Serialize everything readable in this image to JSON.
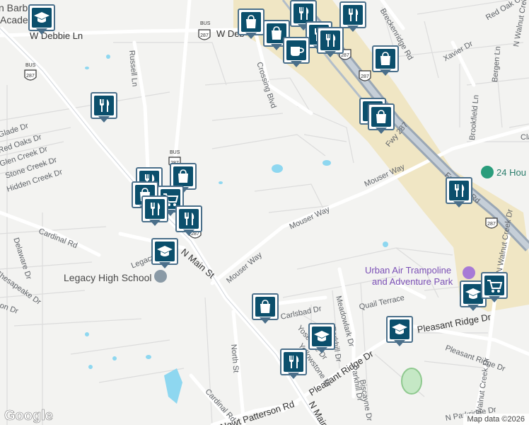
{
  "street_labels": [
    {
      "text": "W Debbie Ln",
      "name": "street-label-w-debbie-ln"
    },
    {
      "text": "W Deb",
      "name": "street-label-w-debbie-ln-east"
    },
    {
      "text": "Russell Ln",
      "name": "street-label-russell-ln"
    },
    {
      "text": "Glade Dr",
      "name": "street-label-glade-dr"
    },
    {
      "text": "Red Oaks Dr",
      "name": "street-label-red-oaks-dr"
    },
    {
      "text": "Glen Creek Dr",
      "name": "street-label-glen-creek-dr"
    },
    {
      "text": "Stone Creek Dr",
      "name": "street-label-stone-creek-dr"
    },
    {
      "text": "Hidden Creek Dr",
      "name": "street-label-hidden-creek-dr"
    },
    {
      "text": "Cardinal Rd",
      "name": "street-label-cardinal-rd-west"
    },
    {
      "text": "Delaware Dr",
      "name": "street-label-delaware-dr"
    },
    {
      "text": "Chesapeake Dr",
      "name": "street-label-chesapeake-dr"
    },
    {
      "text": "on Dr",
      "name": "street-label-on-dr"
    },
    {
      "text": "Legacy Dr",
      "name": "street-label-legacy-dr"
    },
    {
      "text": "N Main St",
      "name": "street-label-n-main-st"
    },
    {
      "text": "Mouser Way",
      "name": "street-label-mouser-way"
    },
    {
      "text": "Mouser Way",
      "name": "street-label-mouser-way-middle"
    },
    {
      "text": "Mouser Way",
      "name": "street-label-mouser-way-east"
    },
    {
      "text": "Crossing Blvd",
      "name": "street-label-crossing-blvd"
    },
    {
      "text": "Xavier Dr",
      "name": "street-label-xavier-dr"
    },
    {
      "text": "Red Oak Ct",
      "name": "street-label-red-oak-ct"
    },
    {
      "text": "Breckenridge Rd",
      "name": "street-label-breckenridge-rd"
    },
    {
      "text": "Bergen Ln",
      "name": "street-label-bergen-ln"
    },
    {
      "text": "Brookfield Ln",
      "name": "street-label-brookfield-ln"
    },
    {
      "text": "Cla",
      "name": "street-label-cla"
    },
    {
      "text": "Frontage Rd",
      "name": "street-label-frontage-rd"
    },
    {
      "text": "Fwy 287",
      "name": "street-label-fwy-287"
    },
    {
      "text": "N Walnut Creek Dr",
      "name": "street-label-n-walnut-creek-dr-north"
    },
    {
      "text": "N Walnut Creek Dr",
      "name": "street-label-n-walnut-creek-dr-mid"
    },
    {
      "text": "N Walnut Creek Dr",
      "name": "street-label-n-walnut-creek-dr-south"
    },
    {
      "text": "Quail Terrace",
      "name": "street-label-quail-terrace"
    },
    {
      "text": "Pleasant Ridge Dr",
      "name": "street-label-pleasant-ridge-dr-east"
    },
    {
      "text": "Pleasant Ridge Dr",
      "name": "street-label-pleasant-ridge-dr-west"
    },
    {
      "text": "Carlsbad Dr",
      "name": "street-label-carlsbad-dr"
    },
    {
      "text": "Yosemite Dr",
      "name": "street-label-yosemite-dr"
    },
    {
      "text": "Yellowstone Dr",
      "name": "street-label-yellowstone-dr"
    },
    {
      "text": "Meadowlark Dr",
      "name": "street-label-meadowlark-dr"
    },
    {
      "text": "Parkhill Dr",
      "name": "street-label-parkhill-dr"
    },
    {
      "text": "Parkhill Dr",
      "name": "street-label-parkhill-dr-south"
    },
    {
      "text": "Biscayne Dr",
      "name": "street-label-biscayne-dr"
    },
    {
      "text": "North St",
      "name": "street-label-north-st"
    },
    {
      "text": "Cardinal Rd",
      "name": "street-label-cardinal-rd-south"
    },
    {
      "text": "Newt Patterson Rd",
      "name": "street-label-newt-patterson-rd"
    },
    {
      "text": "N Main",
      "name": "street-label-n-main-south"
    },
    {
      "text": "N Parkridge Dr",
      "name": "street-label-n-parkridge-dr"
    },
    {
      "text": "Pleasant Ridge Dr",
      "name": "street-label-pleasant-ridge-dr-far-east"
    }
  ],
  "places": {
    "legacy_high_school": "Legacy High School",
    "barbers_academy": "n Barb",
    "barbers_academy_line2": "Acade",
    "urban_air": "Urban Air Trampoline",
    "urban_air_line2": "and Adventure Park",
    "twenty_four_hour": "24 Hou"
  },
  "shields": [
    "287",
    "287",
    "287",
    "287",
    "287",
    "287",
    "287"
  ],
  "shield_bus_label": "BUS",
  "markers": [
    {
      "type": "school",
      "label": "school-marker"
    },
    {
      "type": "shopping",
      "label": "shopping-marker"
    },
    {
      "type": "restaurant",
      "label": "restaurant-marker"
    },
    {
      "type": "restaurant",
      "label": "restaurant-marker"
    },
    {
      "type": "shopping",
      "label": "shopping-marker"
    },
    {
      "type": "restaurant",
      "label": "restaurant-marker"
    },
    {
      "type": "restaurant",
      "label": "restaurant-marker"
    },
    {
      "type": "cafe",
      "label": "cafe-marker"
    },
    {
      "type": "shopping",
      "label": "shopping-marker"
    },
    {
      "type": "restaurant",
      "label": "restaurant-marker"
    },
    {
      "type": "shopping",
      "label": "shopping-marker"
    },
    {
      "type": "shopping",
      "label": "shopping-marker"
    },
    {
      "type": "restaurant",
      "label": "restaurant-marker"
    },
    {
      "type": "restaurant",
      "label": "restaurant-marker"
    },
    {
      "type": "shopping",
      "label": "shopping-marker"
    },
    {
      "type": "shopping",
      "label": "shopping-marker"
    },
    {
      "type": "grocery",
      "label": "grocery-marker"
    },
    {
      "type": "restaurant",
      "label": "restaurant-marker"
    },
    {
      "type": "restaurant",
      "label": "restaurant-marker"
    },
    {
      "type": "school",
      "label": "school-marker"
    },
    {
      "type": "shopping",
      "label": "shopping-marker"
    },
    {
      "type": "school",
      "label": "school-marker"
    },
    {
      "type": "school",
      "label": "school-marker"
    },
    {
      "type": "school",
      "label": "school-marker"
    },
    {
      "type": "grocery",
      "label": "grocery-marker"
    },
    {
      "type": "restaurant",
      "label": "restaurant-marker"
    }
  ],
  "attribution": "Map data ©2026",
  "logo": "Google",
  "colors": {
    "land": "#f3f3f1",
    "road": "#ffffff",
    "highway_band": "#f0e6c4",
    "highway": "#9aa7b5",
    "water": "#8ed7f0",
    "park": "#c5e8c5",
    "marker": "#0b4f6c",
    "marker_border": "#4a6f8a"
  }
}
